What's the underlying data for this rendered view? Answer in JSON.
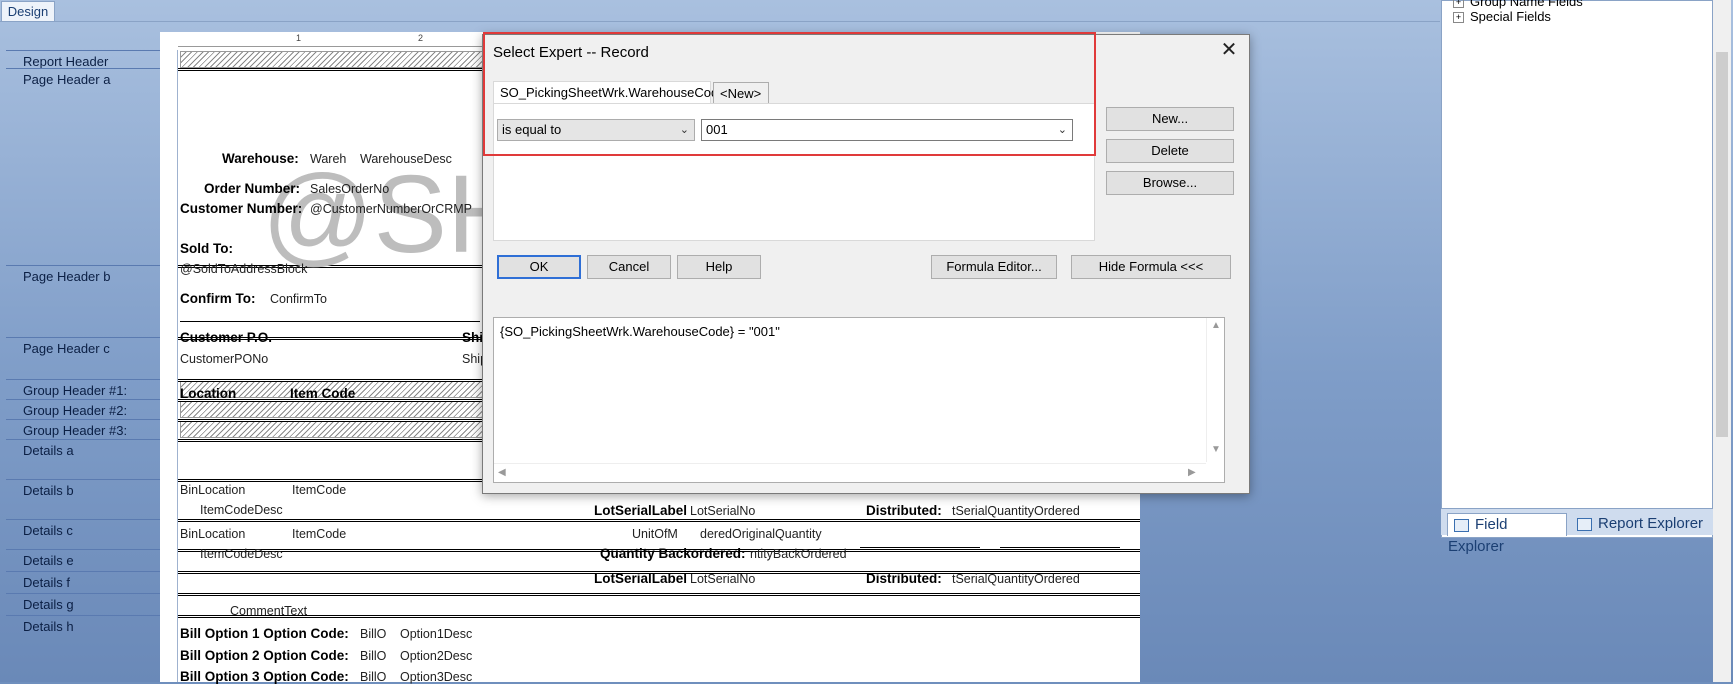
{
  "tab": {
    "design": "Design"
  },
  "sections": [
    "Report Header",
    "Page Header a",
    "Page Header b",
    "Page Header c",
    "Group Header #1:",
    "Group Header #2:",
    "Group Header #3:",
    "Details a",
    "Details b",
    "Details c",
    "Details e",
    "Details f",
    "Details g",
    "Details h"
  ],
  "ruler": {
    "t1": "1",
    "t2": "2"
  },
  "report": {
    "warehouse_label": "Warehouse:",
    "wareh": "Wareh",
    "warehouse_desc": "WarehouseDesc",
    "order_label": "Order Number:",
    "sales_order": "SalesOrderNo",
    "customer_label": "Customer Number:",
    "customer_field": "@CustomerNumberOrCRMP",
    "sold_to": "Sold To:",
    "sold_to_block": "@SoldToAddressBlock",
    "watermark": "@SH",
    "confirm_label": "Confirm To:",
    "confirm_field": "ConfirmTo",
    "customer_po": "Customer P.O.",
    "ship": "Ship",
    "customer_po_no": "CustomerPONo",
    "ship2": "Ship",
    "location": "Location",
    "item_code_hdr": "Item Code",
    "bin_a": "BinLocation",
    "item_a": "ItemCode",
    "desc_a": "ItemCodeDesc",
    "lotlabel_a": "LotSerialLabel",
    "lotno_a": "LotSerialNo",
    "distributed_a": "Distributed:",
    "qty_a": "tSerialQuantityOrdered",
    "bin_b": "BinLocation",
    "item_b": "ItemCode",
    "unit_b": "UnitOfM",
    "orig_b": "deredOriginalQuantity",
    "desc_b": "ItemCodeDesc",
    "backordered_label": "Quantity Backordered:",
    "backordered_field": "ntityBackOrdered",
    "lotlabel_c": "LotSerialLabel",
    "lotno_c": "LotSerialNo",
    "distributed_c": "Distributed:",
    "qty_c": "tSerialQuantityOrdered",
    "comment": "CommentText",
    "bill1": "Bill Option 1 Option Code:",
    "bill1_f": "BillO",
    "bill1_d": "Option1Desc",
    "bill2": "Bill Option 2 Option Code:",
    "bill2_f": "BillO",
    "bill2_d": "Option2Desc",
    "bill3": "Bill Option 3 Option Code:",
    "bill3_f": "BillO",
    "bill3_d": "Option3Desc"
  },
  "right_panel": {
    "item1": "Group Name Fields",
    "item2": "Special Fields",
    "tab_field": "Field Explorer",
    "tab_report": "Report Explorer"
  },
  "dialog": {
    "title": "Select Expert -- Record",
    "close": "✕",
    "tab_field": "SO_PickingSheetWrk.WarehouseCode",
    "tab_new": "<New>",
    "operator": "is equal to",
    "value": "001",
    "buttons": {
      "new": "New...",
      "delete": "Delete",
      "browse": "Browse...",
      "ok": "OK",
      "cancel": "Cancel",
      "help": "Help",
      "formula_editor": "Formula Editor...",
      "hide_formula": "Hide Formula <<<"
    },
    "formula": "{SO_PickingSheetWrk.WarehouseCode} = \"001\""
  }
}
